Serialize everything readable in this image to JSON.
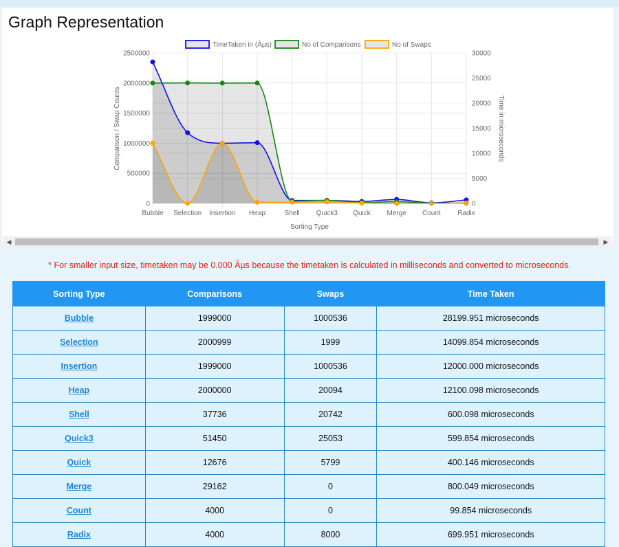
{
  "heading": "Graph Representation",
  "note": "* For smaller input size, timetaken may be 0.000 Âµs because the timetaken is calculated in milliseconds and converted to microseconds.",
  "colors": {
    "time": "#1010ee",
    "comparisons": "#118811",
    "swaps": "#ffa500"
  },
  "chart_data": {
    "type": "line",
    "categories": [
      "Bubble",
      "Selection",
      "Insertion",
      "Heap",
      "Shell",
      "Quick3",
      "Quick",
      "Merge",
      "Count",
      "Radix"
    ],
    "xlabel": "Sorting Type",
    "ylabel": "Comparison / Swap Counts",
    "y2label": "Time in microseconds",
    "ylim": [
      0,
      2500000
    ],
    "y2lim": [
      0,
      30000
    ],
    "yticks": [
      "0",
      "500000",
      "1000000",
      "1500000",
      "2000000",
      "2500000"
    ],
    "y2ticks": [
      "0",
      "5000",
      "10000",
      "15000",
      "20000",
      "25000",
      "30000"
    ],
    "legend_position": "top",
    "grid": true,
    "series": [
      {
        "name": "TimeTaken in (Âµs)",
        "axis": "right",
        "values": [
          28199.951,
          14099.854,
          12000.0,
          12100.098,
          600.098,
          599.854,
          400.146,
          800.049,
          99.854,
          699.951
        ]
      },
      {
        "name": "No of Comparisons",
        "axis": "left",
        "values": [
          1999000,
          2000999,
          1999000,
          2000000,
          37736,
          51450,
          12676,
          29162,
          4000,
          4000
        ]
      },
      {
        "name": "No of Swaps",
        "axis": "left",
        "values": [
          1000536,
          1999,
          1000536,
          20094,
          20742,
          25053,
          5799,
          0,
          0,
          8000
        ]
      }
    ]
  },
  "table": {
    "headers": [
      "Sorting Type",
      "Comparisons",
      "Swaps",
      "Time Taken"
    ],
    "rows": [
      [
        "Bubble",
        "1999000",
        "1000536",
        "28199.951 microseconds"
      ],
      [
        "Selection",
        "2000999",
        "1999",
        "14099.854 microseconds"
      ],
      [
        "Insertion",
        "1999000",
        "1000536",
        "12000.000 microseconds"
      ],
      [
        "Heap",
        "2000000",
        "20094",
        "12100.098 microseconds"
      ],
      [
        "Shell",
        "37736",
        "20742",
        "600.098 microseconds"
      ],
      [
        "Quick3",
        "51450",
        "25053",
        "599.854 microseconds"
      ],
      [
        "Quick",
        "12676",
        "5799",
        "400.146 microseconds"
      ],
      [
        "Merge",
        "29162",
        "0",
        "800.049 microseconds"
      ],
      [
        "Count",
        "4000",
        "0",
        "99.854 microseconds"
      ],
      [
        "Radix",
        "4000",
        "8000",
        "699.951 microseconds"
      ]
    ]
  }
}
